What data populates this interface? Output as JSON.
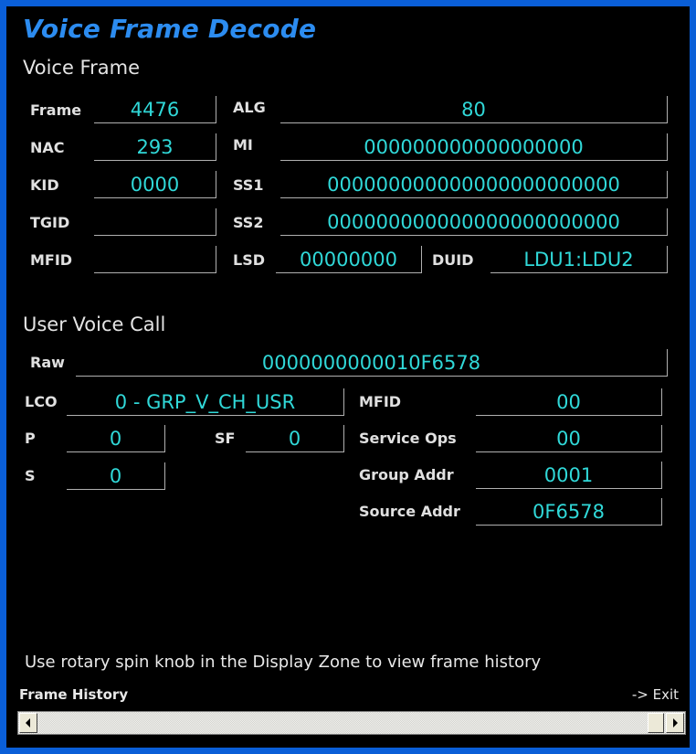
{
  "title": "Voice Frame Decode",
  "voice_frame": {
    "heading": "Voice Frame",
    "fields": {
      "frame": {
        "label": "Frame",
        "value": "4476"
      },
      "nac": {
        "label": "NAC",
        "value": "293"
      },
      "kid": {
        "label": "KID",
        "value": "0000"
      },
      "tgid": {
        "label": "TGID",
        "value": ""
      },
      "mfid": {
        "label": "MFID",
        "value": ""
      },
      "alg": {
        "label": "ALG",
        "value": "80"
      },
      "mi": {
        "label": "MI",
        "value": "000000000000000000"
      },
      "ss1": {
        "label": "SS1",
        "value": "000000000000000000000000"
      },
      "ss2": {
        "label": "SS2",
        "value": "000000000000000000000000"
      },
      "lsd": {
        "label": "LSD",
        "value": "00000000"
      },
      "duid": {
        "label": "DUID",
        "value": "LDU1:LDU2"
      }
    }
  },
  "user_voice_call": {
    "heading": "User Voice Call",
    "fields": {
      "raw": {
        "label": "Raw",
        "value": "0000000000010F6578"
      },
      "lco": {
        "label": "LCO",
        "value": "0 - GRP_V_CH_USR"
      },
      "p": {
        "label": "P",
        "value": "0"
      },
      "sf": {
        "label": "SF",
        "value": "0"
      },
      "s": {
        "label": "S",
        "value": "0"
      },
      "mfid": {
        "label": "MFID",
        "value": "00"
      },
      "service_ops": {
        "label": "Service Ops",
        "value": "00"
      },
      "group_addr": {
        "label": "Group Addr",
        "value": "0001"
      },
      "source_addr": {
        "label": "Source Addr",
        "value": "0F6578"
      }
    }
  },
  "hint": "Use rotary spin knob in the Display Zone to view frame history",
  "frame_history_label": "Frame History",
  "exit_label": "-> Exit",
  "scrollbar": {
    "left_arrow": "◀",
    "right_arrow": "▶"
  },
  "colors": {
    "window_border": "#0a5fd8",
    "title": "#2c8cf0",
    "value": "#30d8d8",
    "background": "#000000"
  }
}
